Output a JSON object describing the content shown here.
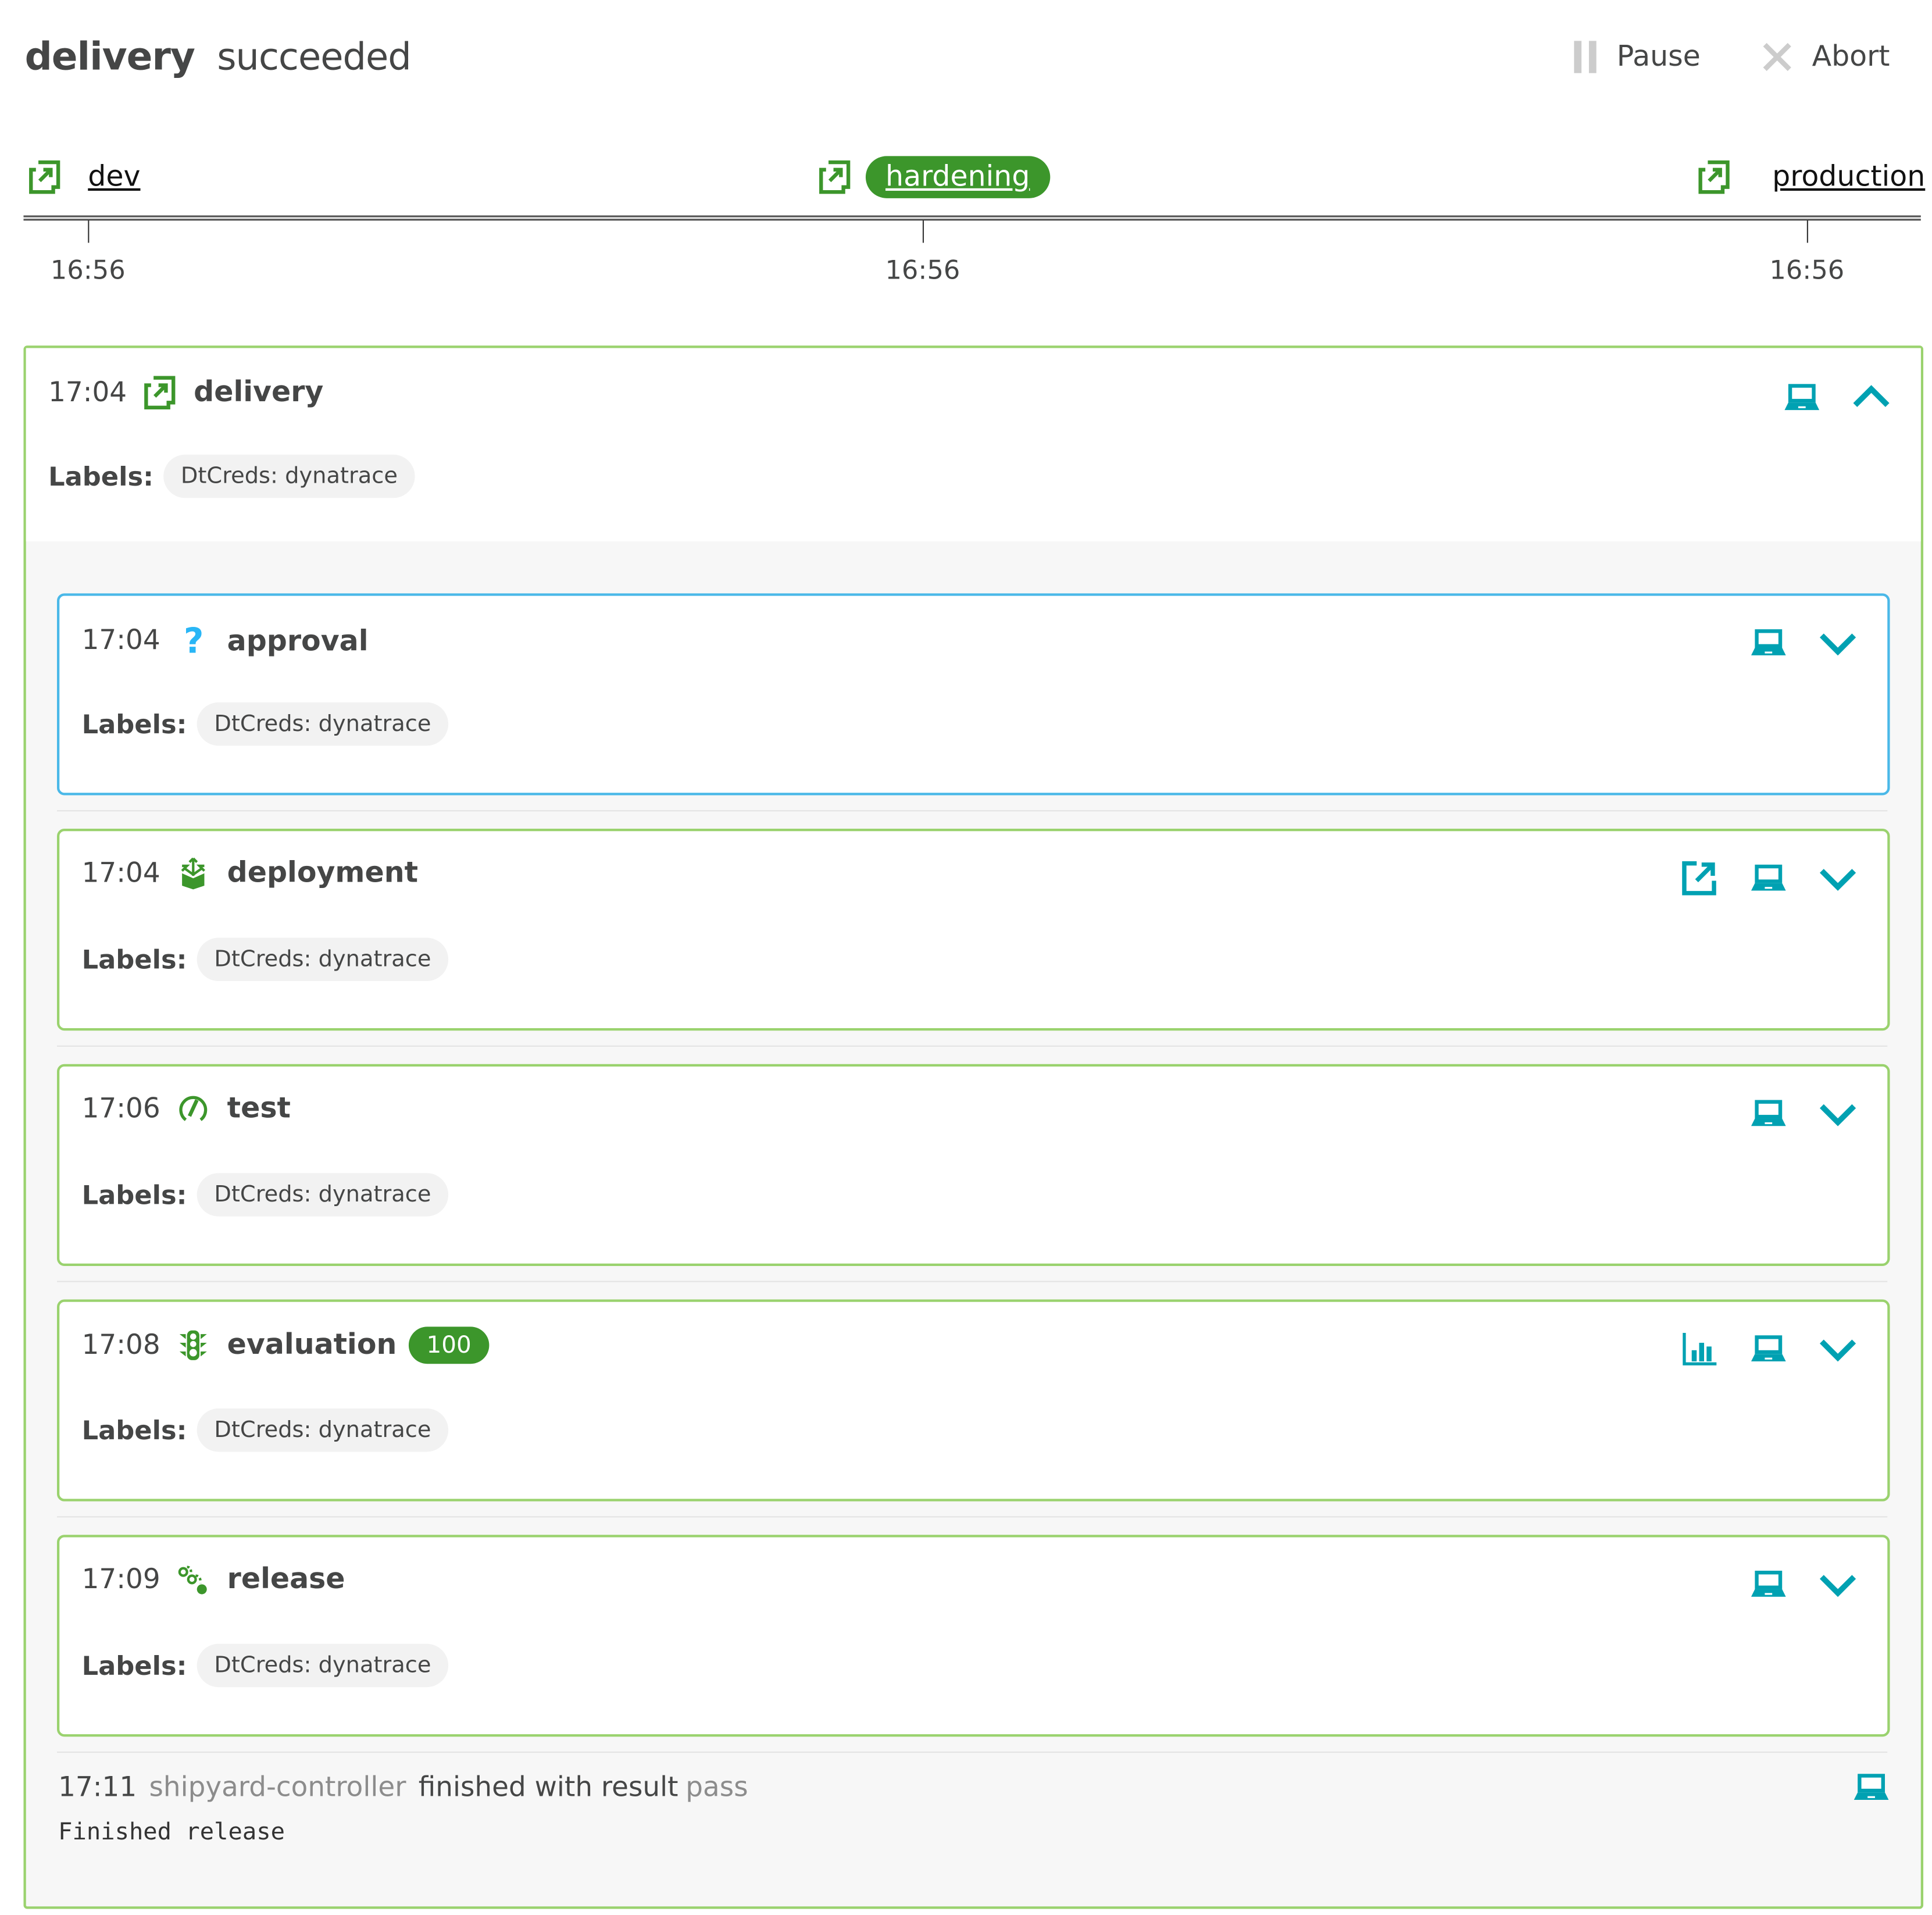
{
  "header": {
    "sequence_name": "delivery",
    "status": "succeeded",
    "pause_label": "Pause",
    "abort_label": "Abort"
  },
  "timeline": {
    "stages": [
      {
        "name": "dev",
        "time": "16:56",
        "active": false
      },
      {
        "name": "hardening",
        "time": "16:56",
        "active": true
      },
      {
        "name": "production",
        "time": "16:56",
        "active": false
      }
    ]
  },
  "sequence": {
    "time": "17:04",
    "name": "delivery",
    "labels_key": "Labels:",
    "label_chip": "DtCreds: dynatrace",
    "expanded": true
  },
  "tasks": [
    {
      "time": "17:04",
      "name": "approval",
      "icon": "question-icon",
      "labels_key": "Labels:",
      "label_chip": "DtCreds: dynatrace"
    },
    {
      "time": "17:04",
      "name": "deployment",
      "icon": "deploy-box-icon",
      "labels_key": "Labels:",
      "label_chip": "DtCreds: dynatrace"
    },
    {
      "time": "17:06",
      "name": "test",
      "icon": "gauge-icon",
      "labels_key": "Labels:",
      "label_chip": "DtCreds: dynatrace"
    },
    {
      "time": "17:08",
      "name": "evaluation",
      "icon": "traffic-light-icon",
      "score": "100",
      "labels_key": "Labels:",
      "label_chip": "DtCreds: dynatrace"
    },
    {
      "time": "17:09",
      "name": "release",
      "icon": "release-path-icon",
      "labels_key": "Labels:",
      "label_chip": "DtCreds: dynatrace"
    }
  ],
  "final_event": {
    "time": "17:11",
    "source": "shipyard-controller",
    "text": "finished with result",
    "result": "pass",
    "message": "Finished release"
  },
  "colors": {
    "success_green": "#3c962b",
    "border_green": "#9ad26e",
    "approval_blue": "#4ab8e8",
    "action_teal": "#00a1b2"
  }
}
